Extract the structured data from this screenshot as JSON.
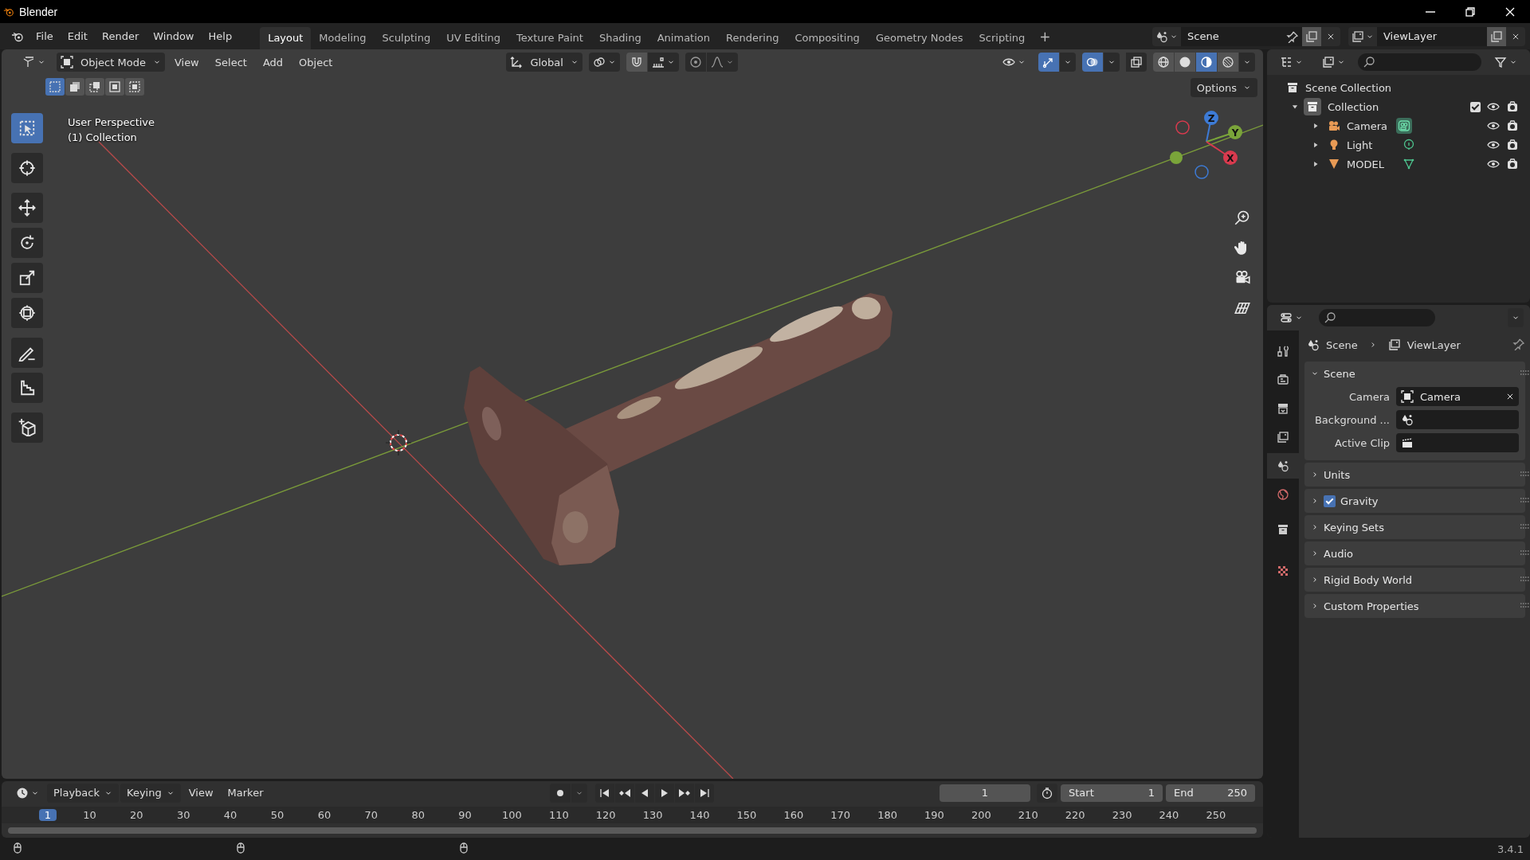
{
  "window": {
    "title": "Blender"
  },
  "menu": [
    "File",
    "Edit",
    "Render",
    "Window",
    "Help"
  ],
  "workspaces": [
    {
      "label": "Layout",
      "selected": true
    },
    {
      "label": "Modeling",
      "selected": false
    },
    {
      "label": "Sculpting",
      "selected": false
    },
    {
      "label": "UV Editing",
      "selected": false
    },
    {
      "label": "Texture Paint",
      "selected": false
    },
    {
      "label": "Shading",
      "selected": false
    },
    {
      "label": "Animation",
      "selected": false
    },
    {
      "label": "Rendering",
      "selected": false
    },
    {
      "label": "Compositing",
      "selected": false
    },
    {
      "label": "Geometry Nodes",
      "selected": false
    },
    {
      "label": "Scripting",
      "selected": false
    }
  ],
  "add_workspace": "+",
  "scene": {
    "value": "Scene"
  },
  "view_layer": {
    "value": "ViewLayer"
  },
  "viewport": {
    "mode": "Object Mode",
    "menus": [
      "View",
      "Select",
      "Add",
      "Object"
    ],
    "orientation": "Global",
    "toggles": [
      {
        "kind": "gizmos",
        "on": true
      },
      {
        "kind": "overlays",
        "on": true
      },
      {
        "kind": "xray",
        "on": false
      }
    ],
    "shading": [
      {
        "kind": "wireframe",
        "selected": false
      },
      {
        "kind": "solid",
        "selected": false
      },
      {
        "kind": "material",
        "selected": true
      },
      {
        "kind": "rendered",
        "selected": false
      }
    ],
    "select_modes": [
      {
        "kind": "new",
        "selected": true
      },
      {
        "kind": "extend",
        "selected": false
      },
      {
        "kind": "subtract",
        "selected": false
      },
      {
        "kind": "invert",
        "selected": false
      },
      {
        "kind": "intersect",
        "selected": false
      }
    ],
    "options": "Options",
    "tools": [
      {
        "kind": "select",
        "selected": true
      },
      {
        "kind": "cursor",
        "selected": false
      },
      {
        "kind": "move",
        "selected": false
      },
      {
        "kind": "rotate",
        "selected": false
      },
      {
        "kind": "scale",
        "selected": false
      },
      {
        "kind": "transform",
        "selected": false
      },
      {
        "kind": "annotate",
        "selected": false
      },
      {
        "kind": "measure",
        "selected": false
      },
      {
        "kind": "add-cube",
        "selected": false
      }
    ],
    "info": [
      "User Perspective",
      "(1) Collection"
    ],
    "gizmo_axes": [
      "Z",
      "Y",
      "X"
    ]
  },
  "outliner": {
    "root": {
      "label": "Scene Collection",
      "children": [
        {
          "label": "Collection",
          "expanded": true,
          "checked": true,
          "children": [
            {
              "label": "Camera",
              "kind": "camera",
              "expanded": false
            },
            {
              "label": "Light",
              "kind": "light",
              "expanded": false
            },
            {
              "label": "MODEL",
              "kind": "mesh",
              "expanded": false
            }
          ]
        }
      ]
    }
  },
  "properties": {
    "tabs": [
      {
        "kind": "tool",
        "selected": false
      },
      {
        "kind": "render",
        "selected": false
      },
      {
        "kind": "output",
        "selected": false
      },
      {
        "kind": "view-layer",
        "selected": false
      },
      {
        "kind": "scene",
        "selected": true
      },
      {
        "kind": "world",
        "selected": false
      },
      {
        "kind": "collection",
        "selected": false
      },
      {
        "kind": "texture",
        "selected": false
      }
    ],
    "breadcrumb": [
      "Scene",
      "ViewLayer"
    ],
    "panels": [
      {
        "title": "Scene",
        "kind": "plain",
        "expanded": true,
        "fields": [
          {
            "label": "Camera",
            "kind": "camera",
            "value": "Camera"
          },
          {
            "label": "Background ...",
            "kind": "scene"
          },
          {
            "label": "Active Clip",
            "kind": "clip"
          }
        ]
      },
      {
        "title": "Units",
        "kind": "plain",
        "expanded": false
      },
      {
        "title": "Gravity",
        "kind": "checkbox",
        "checked": true,
        "expanded": false
      },
      {
        "title": "Keying Sets",
        "kind": "plain",
        "expanded": false
      },
      {
        "title": "Audio",
        "kind": "plain",
        "expanded": false
      },
      {
        "title": "Rigid Body World",
        "kind": "plain",
        "expanded": false
      },
      {
        "title": "Custom Properties",
        "kind": "plain",
        "expanded": false
      }
    ]
  },
  "timeline": {
    "menus": [
      "Playback",
      "Keying",
      "View",
      "Marker"
    ],
    "current_frame": "1",
    "start_label": "Start",
    "start": "1",
    "end_label": "End",
    "end": "250",
    "ruler": {
      "current": "1",
      "ticks": [
        "10",
        "20",
        "30",
        "40",
        "50",
        "60",
        "70",
        "80",
        "90",
        "100",
        "110",
        "120",
        "130",
        "140",
        "150",
        "160",
        "170",
        "180",
        "190",
        "200",
        "210",
        "220",
        "230",
        "240",
        "250"
      ]
    }
  },
  "status_bar": {
    "version": "3.4.1"
  }
}
